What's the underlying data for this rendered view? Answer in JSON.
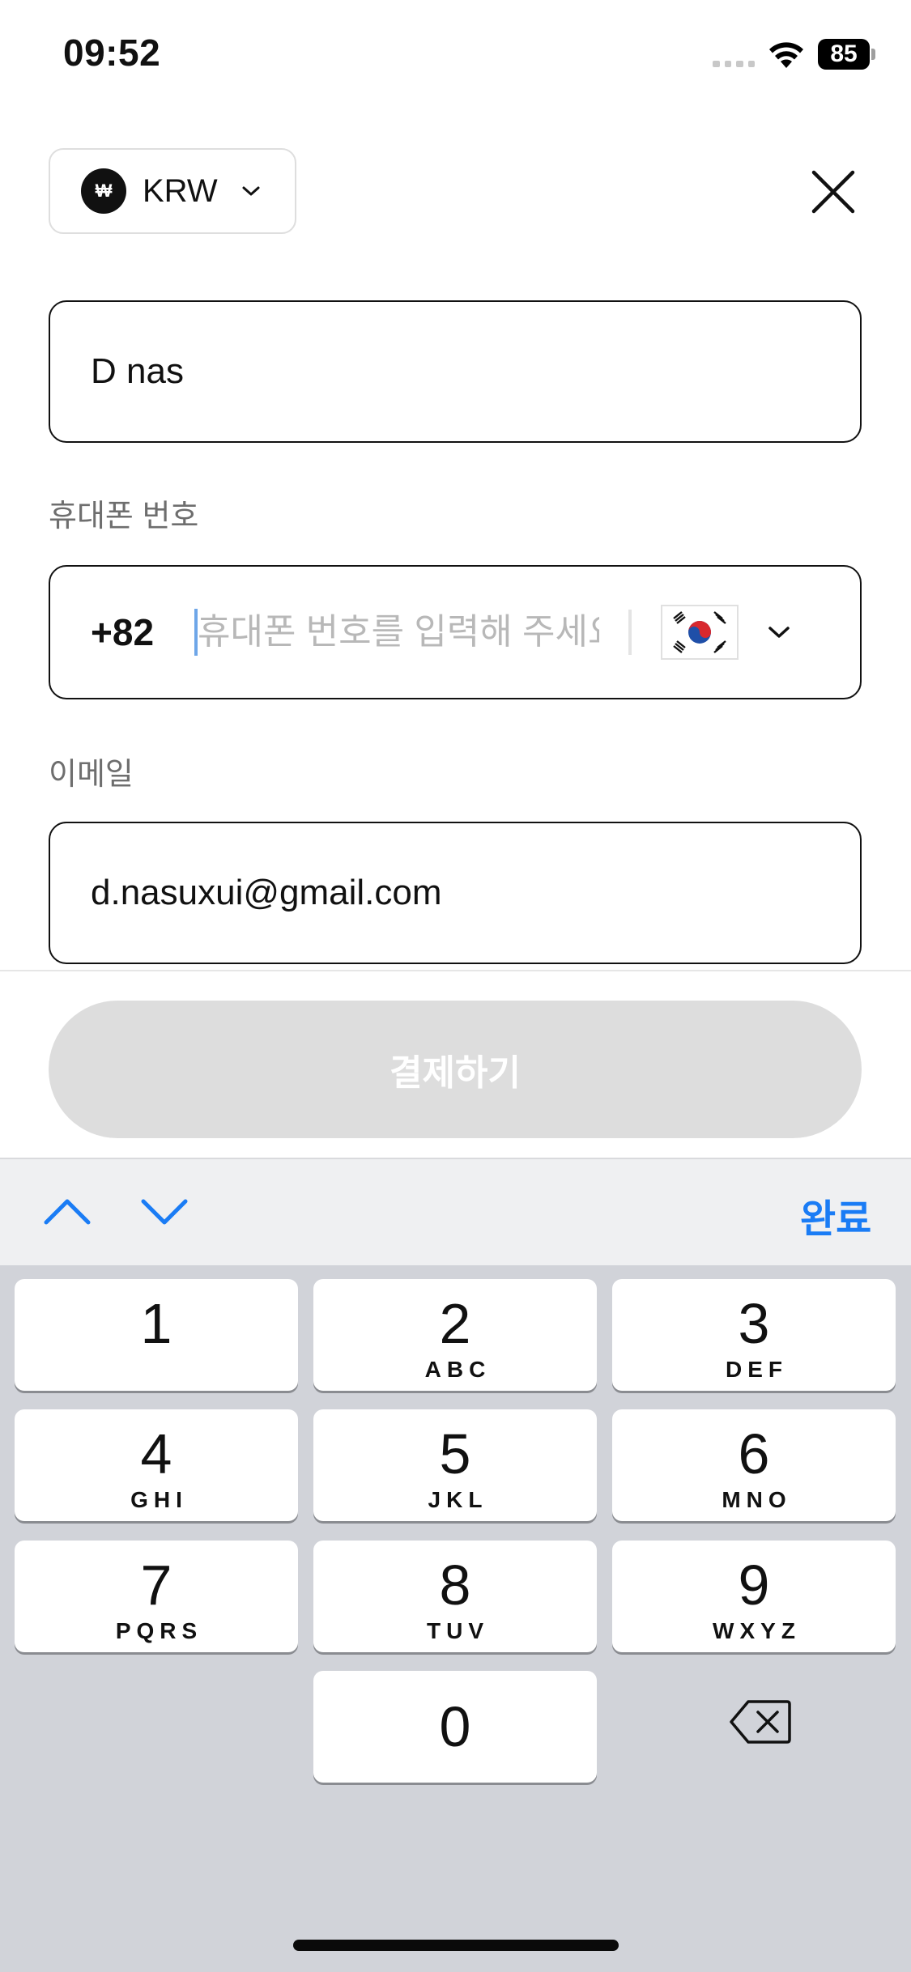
{
  "status_bar": {
    "time": "09:52",
    "battery": "85"
  },
  "currency": {
    "symbol": "₩",
    "code": "KRW"
  },
  "form": {
    "name_value": "D nas",
    "phone_label": "휴대폰 번호",
    "dial_code": "+82",
    "phone_placeholder": "휴대폰 번호를 입력해 주세요",
    "country_flag": "south-korea-flag",
    "email_label": "이메일",
    "email_value": "d.nasuxui@gmail.com"
  },
  "pay_button": {
    "label": "결제하기"
  },
  "keyboard_accessory": {
    "done_label": "완료"
  },
  "keypad": {
    "keys": [
      {
        "digit": "1",
        "letters": ""
      },
      {
        "digit": "2",
        "letters": "ABC"
      },
      {
        "digit": "3",
        "letters": "DEF"
      },
      {
        "digit": "4",
        "letters": "GHI"
      },
      {
        "digit": "5",
        "letters": "JKL"
      },
      {
        "digit": "6",
        "letters": "MNO"
      },
      {
        "digit": "7",
        "letters": "PQRS"
      },
      {
        "digit": "8",
        "letters": "TUV"
      },
      {
        "digit": "9",
        "letters": "WXYZ"
      },
      {
        "digit": "0",
        "letters": ""
      }
    ]
  },
  "colors": {
    "accent": "#1a7cf5",
    "button_disabled": "#dddddd",
    "keyboard_bg": "#d1d3d9"
  }
}
